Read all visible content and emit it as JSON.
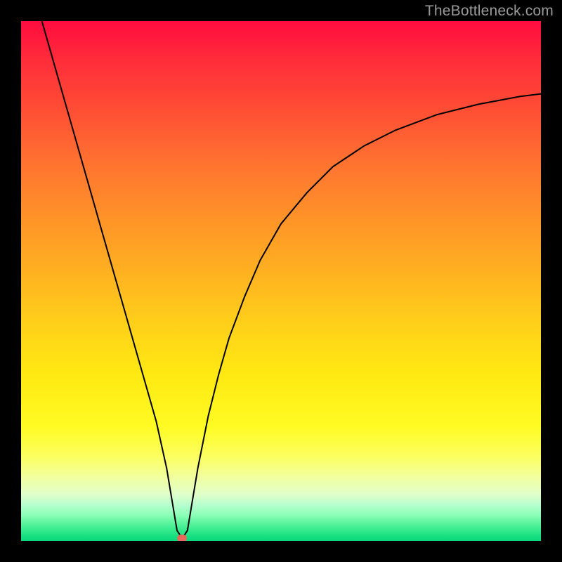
{
  "watermark": "TheBottleneck.com",
  "chart_data": {
    "type": "line",
    "title": "",
    "xlabel": "",
    "ylabel": "",
    "xlim": [
      0,
      100
    ],
    "ylim": [
      0,
      100
    ],
    "grid": false,
    "legend": false,
    "background": "red-yellow-green-vertical-gradient",
    "series": [
      {
        "name": "bottleneck-curve",
        "color": "#000000",
        "x": [
          4,
          6,
          8,
          10,
          12,
          14,
          16,
          18,
          20,
          22,
          24,
          26,
          28,
          29,
          30,
          31,
          32,
          33,
          34,
          36,
          38,
          40,
          43,
          46,
          50,
          55,
          60,
          66,
          72,
          80,
          88,
          96,
          100
        ],
        "y": [
          100,
          93,
          86,
          79,
          72,
          65,
          58,
          51,
          44,
          37,
          30,
          23,
          14,
          8,
          2,
          0.5,
          2,
          8,
          14,
          24,
          32,
          39,
          47,
          54,
          61,
          67,
          72,
          76,
          79,
          82,
          84,
          85.5,
          86
        ]
      }
    ],
    "marker": {
      "name": "optimal-point",
      "x": 31,
      "y": 0.5,
      "color": "#e66a5c",
      "shape": "rounded-rect"
    }
  }
}
